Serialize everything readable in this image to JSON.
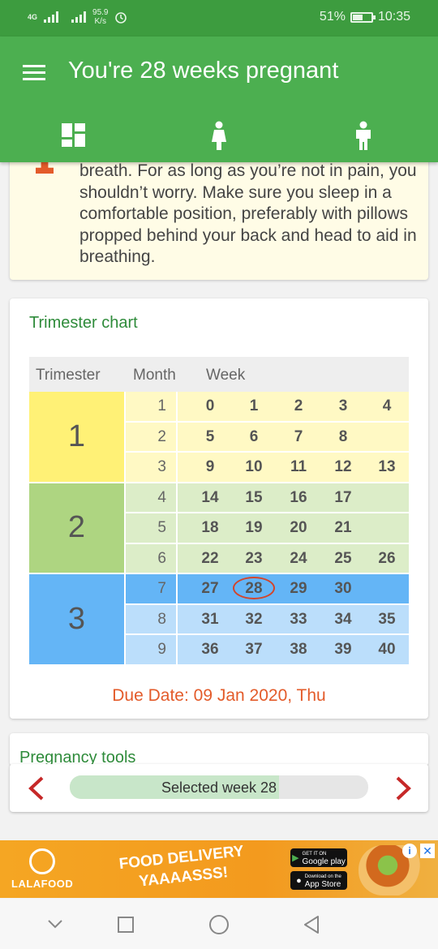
{
  "status_bar": {
    "network_type": "4G",
    "speed_value": "95.9",
    "speed_unit": "K/s",
    "battery_percent": "51%",
    "time": "10:35"
  },
  "app_bar": {
    "title": "You're 28 weeks pregnant",
    "tabs": [
      {
        "name": "dashboard",
        "icon": "dashboard-icon",
        "active": true
      },
      {
        "name": "mother",
        "icon": "pregnant-woman-icon",
        "active": false
      },
      {
        "name": "baby",
        "icon": "child-icon",
        "active": false
      }
    ]
  },
  "tip_card": {
    "text": "breath. For as long as you’re not in pain, you shouldn’t worry. Make sure you sleep in a comfortable position, preferably with pillows propped behind your back and head to aid in breathing."
  },
  "trimester_chart": {
    "title": "Trimester chart",
    "headers": {
      "trimester": "Trimester",
      "month": "Month",
      "week": "Week"
    },
    "trimesters": [
      {
        "label": "1",
        "color": "#fff176",
        "light_color": "#fff9c4",
        "months": [
          {
            "month": "1",
            "weeks": [
              "0",
              "1",
              "2",
              "3",
              "4"
            ]
          },
          {
            "month": "2",
            "weeks": [
              "5",
              "6",
              "7",
              "8",
              ""
            ]
          },
          {
            "month": "3",
            "weeks": [
              "9",
              "10",
              "11",
              "12",
              "13"
            ]
          }
        ]
      },
      {
        "label": "2",
        "color": "#aed581",
        "light_color": "#dcedc8",
        "months": [
          {
            "month": "4",
            "weeks": [
              "14",
              "15",
              "16",
              "17",
              ""
            ]
          },
          {
            "month": "5",
            "weeks": [
              "18",
              "19",
              "20",
              "21",
              ""
            ]
          },
          {
            "month": "6",
            "weeks": [
              "22",
              "23",
              "24",
              "25",
              "26"
            ]
          }
        ]
      },
      {
        "label": "3",
        "color": "#64b5f6",
        "light_color": "#bbdefb",
        "months": [
          {
            "month": "7",
            "weeks": [
              "27",
              "28",
              "29",
              "30",
              ""
            ]
          },
          {
            "month": "8",
            "weeks": [
              "31",
              "32",
              "33",
              "34",
              "35"
            ]
          },
          {
            "month": "9",
            "weeks": [
              "36",
              "37",
              "38",
              "39",
              "40"
            ]
          }
        ]
      }
    ],
    "current_week": "28",
    "current_month": "7",
    "due_date": "Due Date: 09 Jan 2020, Thu"
  },
  "pregnancy_tools": {
    "title": "Pregnancy tools"
  },
  "week_selector": {
    "label": "Selected week 28",
    "selected_week": 28,
    "total_weeks": 40,
    "arrow_color": "#c62828"
  },
  "ad_banner": {
    "brand": "LALAFOOD",
    "headline_line1": "FOOD DELIVERY",
    "headline_line2": "YAAAASSS!",
    "google_play_small": "GET IT ON",
    "google_play": "Google play",
    "app_store_small": "Download on the",
    "app_store": "App Store",
    "info_icon": "info-icon",
    "close_icon": "close-icon"
  },
  "nav_bar": {
    "buttons": [
      "back-chevron-icon",
      "recents-square-icon",
      "home-circle-icon",
      "back-triangle-icon"
    ]
  }
}
